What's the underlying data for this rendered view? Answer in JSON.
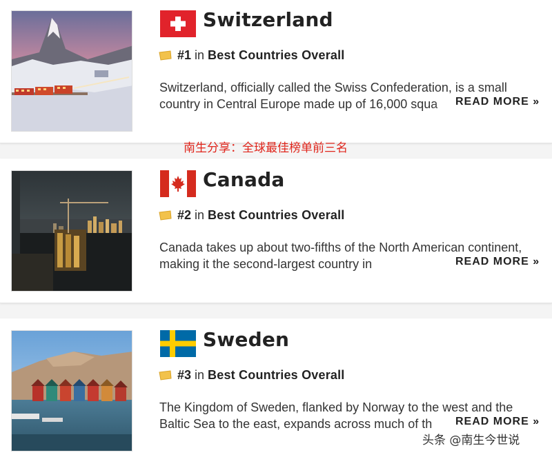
{
  "overlay": {
    "share_note": "南生分享：全球最佳榜单前三名",
    "author_watermark": "头条 @南生今世说"
  },
  "countries": [
    {
      "name": "Switzerland",
      "rank": "#1",
      "in_word": "in",
      "ranking_link": "Best Countries Overall",
      "description": "Switzerland, officially called the Swiss Confederation, is a small country in Central Europe made up of 16,000 squa",
      "read_more": "READ MORE »",
      "photo_icon": "matterhorn-train-photo",
      "flag_icon": "swiss-flag-icon"
    },
    {
      "name": "Canada",
      "rank": "#2",
      "in_word": "in",
      "ranking_link": "Best Countries Overall",
      "description": "Canada takes up about two-fifths of the North American continent, making it the second-largest country in",
      "read_more": "READ MORE »",
      "photo_icon": "vancouver-skyline-photo",
      "flag_icon": "canada-flag-icon"
    },
    {
      "name": "Sweden",
      "rank": "#3",
      "in_word": "in",
      "ranking_link": "Best Countries Overall",
      "description": "The Kingdom of Sweden, flanked by Norway to the west and the Baltic Sea to the east, expands across much of th",
      "read_more": "READ MORE »",
      "photo_icon": "fishing-huts-harbor-photo",
      "flag_icon": "sweden-flag-icon"
    }
  ],
  "colors": {
    "watermark_red": "#e0251b",
    "ribbon_gold": "#f2c24b",
    "swiss_red": "#e1232b",
    "canada_red": "#d52b1e",
    "sweden_blue": "#006aa7",
    "sweden_yellow": "#fecc00"
  }
}
